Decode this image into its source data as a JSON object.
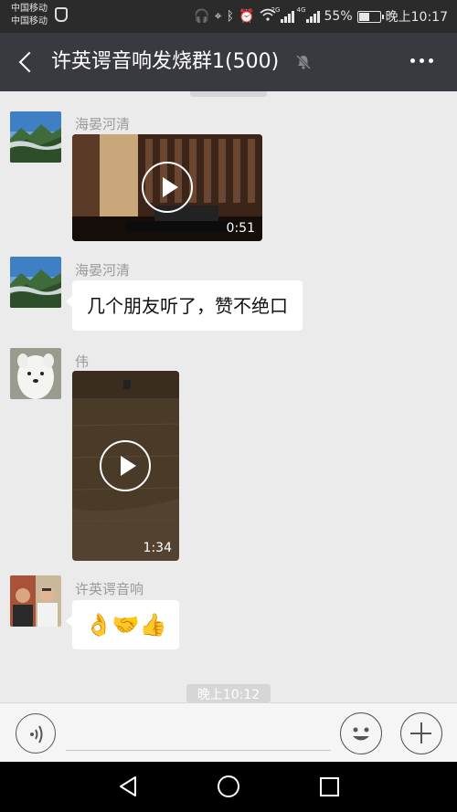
{
  "status_bar": {
    "carrier_1": "中国移动",
    "carrier_2": "中国移动",
    "network_1": "2G",
    "network_2": "4G",
    "battery": "55%",
    "battery_level": 0.55,
    "time": "晚上10:17"
  },
  "header": {
    "title": "许英谔音响发烧群1(500)",
    "muted": true
  },
  "messages": [
    {
      "sender": "海晏河清",
      "type": "video",
      "duration": "0:51"
    },
    {
      "sender": "海晏河清",
      "type": "text",
      "text": "几个朋友听了，赞不绝口"
    },
    {
      "sender": "伟",
      "type": "video",
      "duration": "1:34"
    },
    {
      "sender": "许英谔音响",
      "type": "emoji",
      "emojis": [
        "👌",
        "🤝",
        "👍"
      ]
    }
  ],
  "timestamp": "晚上10:12",
  "input": {
    "value": "",
    "placeholder": ""
  },
  "colors": {
    "title_bar": "#393a3f",
    "status_bar": "#2b2b2b",
    "chat_bg": "#ebebeb",
    "bubble": "#ffffff"
  }
}
